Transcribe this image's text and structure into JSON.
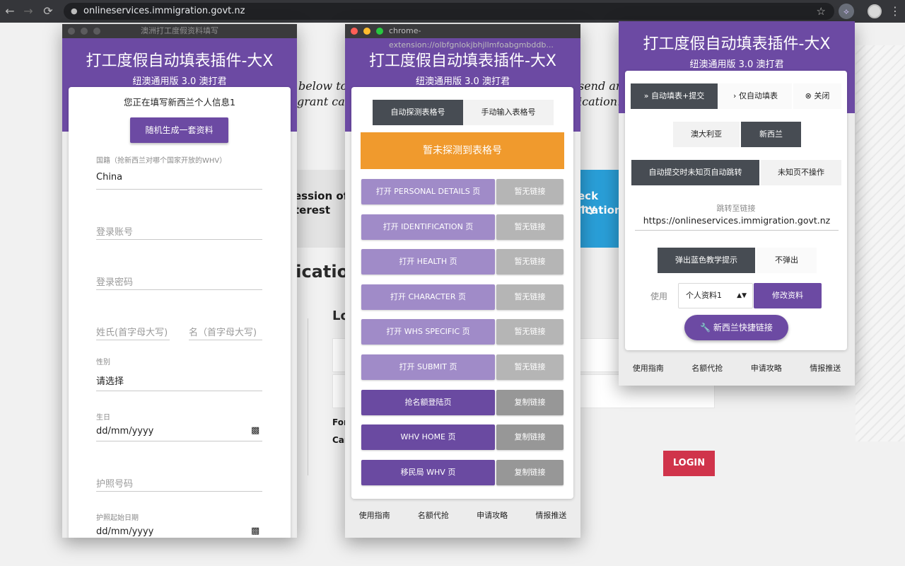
{
  "browser": {
    "url": "onlineservices.immigration.govt.nz",
    "back": "←",
    "forward": "→",
    "reload": "⟳",
    "star": "☆",
    "menu": "⋮",
    "ext_icon": "⟡"
  },
  "background_page": {
    "text1": "below to c",
    "text2": "grant cate",
    "text3": "send an",
    "text4": "ication.",
    "bold1": "ession of",
    "bold2": "terest",
    "bold3": "eck my",
    "bold4": "lication",
    "big": "licatio",
    "lo": "Lo",
    "for": "For",
    "car": "Car",
    "login": "LOGIN"
  },
  "window1": {
    "window_title": "澳洲打工度假资料填写",
    "header_title": "打工度假自动填表插件-大X",
    "header_subtitle": "纽澳通用版 3.0  澳打君",
    "heading": "您正在填写新西兰个人信息1",
    "random_button": "随机生成一套资料",
    "nationality_label": "国籍（抢新西兰对哪个国家开放的WHV）",
    "nationality_value": "China",
    "login_account_placeholder": "登录账号",
    "login_password_placeholder": "登录密码",
    "surname_placeholder": "姓氏(首字母大写)",
    "given_name_placeholder": "名（首字母大写)",
    "gender_label": "性别",
    "gender_value": "请选择",
    "birthday_label": "生日",
    "birthday_value": "dd/mm/yyyy",
    "passport_placeholder": "护照号码",
    "passport_start_label": "护照起始日期",
    "passport_start_value": "dd/mm/yyyy"
  },
  "window2": {
    "window_title": "chrome-extension://olbfgnlokjbhjllmfoabgmbddb...",
    "header_title": "打工度假自动填表插件-大X",
    "header_subtitle": "纽澳通用版 3.0  澳打君",
    "tab_auto": "自动探测表格号",
    "tab_manual": "手动输入表格号",
    "status_banner": "暂未探测到表格号",
    "rows": [
      {
        "open": "打开 PERSONAL DETAILS 页",
        "action": "暂无链接"
      },
      {
        "open": "打开 IDENTIFICATION 页",
        "action": "暂无链接"
      },
      {
        "open": "打开 HEALTH 页",
        "action": "暂无链接"
      },
      {
        "open": "打开 CHARACTER 页",
        "action": "暂无链接"
      },
      {
        "open": "打开 WHS SPECIFIC 页",
        "action": "暂无链接"
      },
      {
        "open": "打开 SUBMIT 页",
        "action": "暂无链接"
      },
      {
        "open": "抢名额登陆页",
        "action": "复制链接"
      },
      {
        "open": "WHV HOME 页",
        "action": "复制链接"
      },
      {
        "open": "移民局 WHV 页",
        "action": "复制链接"
      }
    ],
    "footer": [
      "使用指南",
      "名额代抢",
      "申请攻略",
      "情报推送"
    ]
  },
  "window3": {
    "header_title": "打工度假自动填表插件-大X",
    "header_subtitle": "纽澳通用版 3.0  澳打君",
    "mode_fill_submit": "自动填表+提交",
    "mode_fill_only": "仅自动填表",
    "mode_close": "关闭",
    "country_au": "澳大利亚",
    "country_nz": "新西兰",
    "unknown_jump": "自动提交时未知页自动跳转",
    "unknown_none": "未知页不操作",
    "jump_label": "跳转至链接",
    "jump_value": "https://onlineservices.immigration.govt.nz",
    "tip_show": "弹出蓝色教学提示",
    "tip_hide": "不弹出",
    "use_label": "使用",
    "profile_selected": "个人资料1",
    "edit_profile": "修改资料",
    "nz_quick_link": "新西兰快捷链接",
    "footer": [
      "使用指南",
      "名额代抢",
      "申请攻略",
      "情报推送"
    ]
  },
  "colors": {
    "purple": "#6c4aa3",
    "light_purple": "#a08bc8",
    "dark_purple": "#6a4aa1",
    "orange": "#f09a2d",
    "gray_btn": "#b5b5b5",
    "dark_gray_btn": "#979797",
    "dark_tab": "#474c53",
    "login_red": "#d0344b"
  }
}
